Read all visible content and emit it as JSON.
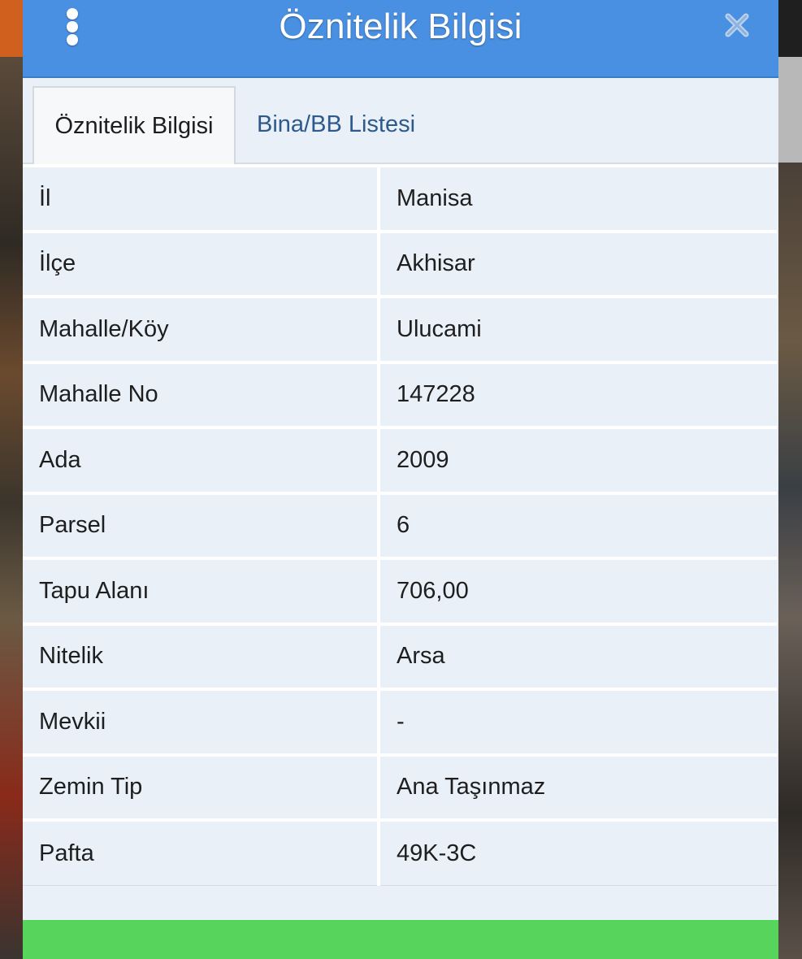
{
  "window": {
    "title": "Öznitelik Bilgisi",
    "menu_icon": "vertical-ellipsis-icon",
    "close_icon": "close-icon",
    "accent_color": "#4a90e2",
    "footer_color": "#57d45c"
  },
  "tabs": [
    {
      "label": "Öznitelik Bilgisi",
      "active": true
    },
    {
      "label": "Bina/BB Listesi",
      "active": false
    }
  ],
  "attributes": [
    {
      "key": "İl",
      "value": "Manisa"
    },
    {
      "key": "İlçe",
      "value": "Akhisar"
    },
    {
      "key": "Mahalle/Köy",
      "value": "Ulucami"
    },
    {
      "key": "Mahalle No",
      "value": "147228"
    },
    {
      "key": "Ada",
      "value": "2009"
    },
    {
      "key": "Parsel",
      "value": "6"
    },
    {
      "key": "Tapu Alanı",
      "value": "706,00"
    },
    {
      "key": "Nitelik",
      "value": "Arsa"
    },
    {
      "key": "Mevkii",
      "value": "-"
    },
    {
      "key": "Zemin Tip",
      "value": "Ana Taşınmaz"
    },
    {
      "key": "Pafta",
      "value": "49K-3C"
    }
  ]
}
